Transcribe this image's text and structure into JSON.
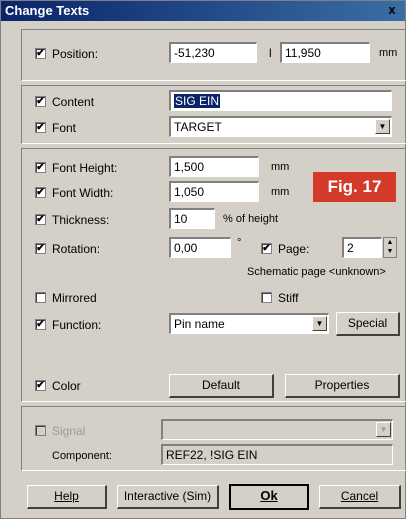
{
  "window": {
    "title": "Change Texts",
    "close": "x"
  },
  "position": {
    "label": "Position:",
    "checked": "✔",
    "x": "-51,230",
    "separator": "l",
    "y": "11,950",
    "unit": "mm"
  },
  "content": {
    "label": "Content",
    "checked": "✔",
    "value": "SIG EIN"
  },
  "font": {
    "label": "Font",
    "checked": "✔",
    "value": "TARGET"
  },
  "font_height": {
    "label": "Font Height:",
    "checked": "✔",
    "value": "1,500",
    "unit": "mm"
  },
  "font_width": {
    "label": "Font Width:",
    "checked": "✔",
    "value": "1,050",
    "unit": "mm"
  },
  "thickness": {
    "label": "Thickness:",
    "checked": "✔",
    "value": "10",
    "unit": "% of height"
  },
  "rotation": {
    "label": "Rotation:",
    "checked": "✔",
    "value": "0,00",
    "unit": "°"
  },
  "page": {
    "label": "Page:",
    "checked": "✔",
    "value": "2",
    "note": "Schematic page <unknown>"
  },
  "mirrored": {
    "label": "Mirrored",
    "checked": ""
  },
  "stiff": {
    "label": "Stiff",
    "checked": ""
  },
  "function": {
    "label": "Function:",
    "checked": "✔",
    "value": "Pin name",
    "special_button": "Special"
  },
  "color": {
    "label": "Color",
    "checked": "✔",
    "default_button": "Default",
    "properties_button": "Properties"
  },
  "signal": {
    "label": "Signal",
    "checked": "",
    "value": ""
  },
  "component": {
    "label": "Component:",
    "value": "REF22, !SIG EIN"
  },
  "buttons": {
    "help": "Help",
    "interactive": "Interactive (Sim)",
    "ok": "Ok",
    "cancel": "Cancel"
  },
  "figure_label": "Fig. 17",
  "colors": {
    "titlebar": "#0a246a",
    "dialog_bg": "#d4d0c8",
    "fig_badge": "#d43a2a"
  }
}
